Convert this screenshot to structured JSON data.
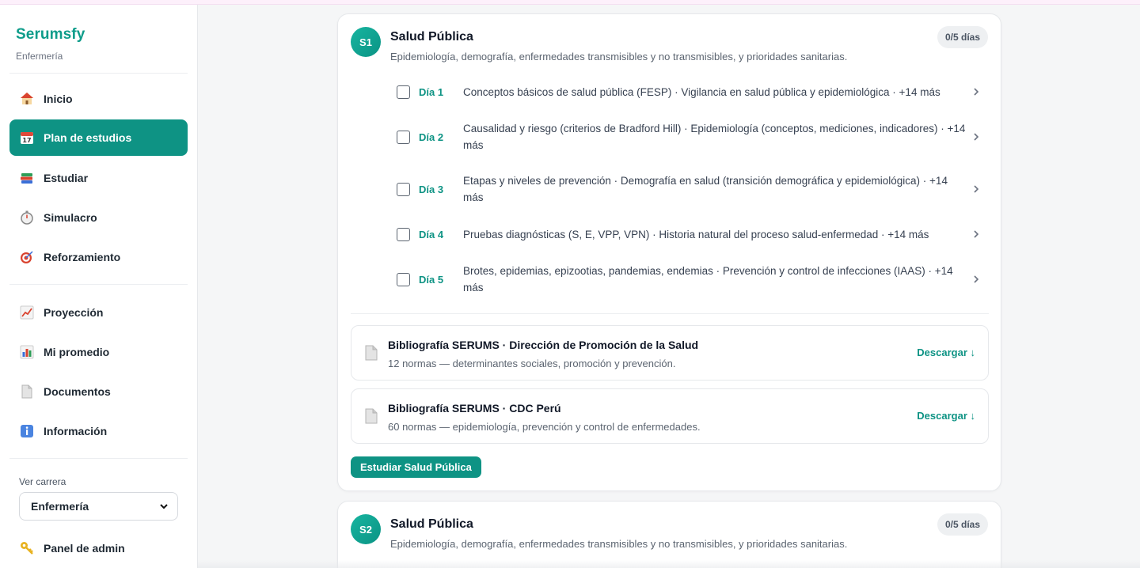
{
  "sidebar": {
    "brand": "Serumsfy",
    "subtitle": "Enfermería",
    "nav_primary": [
      {
        "label": "Inicio",
        "icon": "house-icon"
      },
      {
        "label": "Plan de estudios",
        "icon": "calendar-icon",
        "active": true
      },
      {
        "label": "Estudiar",
        "icon": "books-icon"
      },
      {
        "label": "Simulacro",
        "icon": "stopwatch-icon"
      },
      {
        "label": "Reforzamiento",
        "icon": "target-icon"
      }
    ],
    "nav_secondary": [
      {
        "label": "Proyección",
        "icon": "trend-chart-icon"
      },
      {
        "label": "Mi promedio",
        "icon": "bar-chart-icon"
      },
      {
        "label": "Documentos",
        "icon": "document-icon"
      },
      {
        "label": "Información",
        "icon": "info-icon"
      }
    ],
    "career_label": "Ver carrera",
    "career_selected": "Enfermería",
    "admin_label": "Panel de admin",
    "admin_icon": "key-icon"
  },
  "colors": {
    "accent": "#0e9384",
    "brand": "#0e9c8a"
  },
  "cards": [
    {
      "badge": "S1",
      "title": "Salud Pública",
      "description": "Epidemiología, demografía, enfermedades transmisibles y no transmisibles, y prioridades sanitarias.",
      "days_progress": "0/5 días",
      "days": [
        {
          "label": "Día 1",
          "text": "Conceptos básicos de salud pública (FESP) · Vigilancia en salud pública y epidemiológica · +14 más"
        },
        {
          "label": "Día 2",
          "text": "Causalidad y riesgo (criterios de Bradford Hill) · Epidemiología (conceptos, mediciones, indicadores) · +14 más"
        },
        {
          "label": "Día 3",
          "text": "Etapas y niveles de prevención · Demografía en salud (transición demográfica y epidemiológica) · +14 más"
        },
        {
          "label": "Día 4",
          "text": "Pruebas diagnósticas (S, E, VPP, VPN) · Historia natural del proceso salud-enfermedad · +14 más"
        },
        {
          "label": "Día 5",
          "text": "Brotes, epidemias, epizootias, pandemias, endemias · Prevención y control de infecciones (IAAS) · +14 más"
        }
      ],
      "bibliography": [
        {
          "title": "Bibliografía SERUMS · Dirección de Promoción de la Salud",
          "subtitle": "12 normas — determinantes sociales, promoción y prevención.",
          "action": "Descargar ↓"
        },
        {
          "title": "Bibliografía SERUMS · CDC Perú",
          "subtitle": "60 normas — epidemiología, prevención y control de enfermedades.",
          "action": "Descargar ↓"
        }
      ],
      "study_button": "Estudiar Salud Pública"
    },
    {
      "badge": "S2",
      "title": "Salud Pública",
      "description": "Epidemiología, demografía, enfermedades transmisibles y no transmisibles, y prioridades sanitarias.",
      "days_progress": "0/5 días"
    }
  ]
}
